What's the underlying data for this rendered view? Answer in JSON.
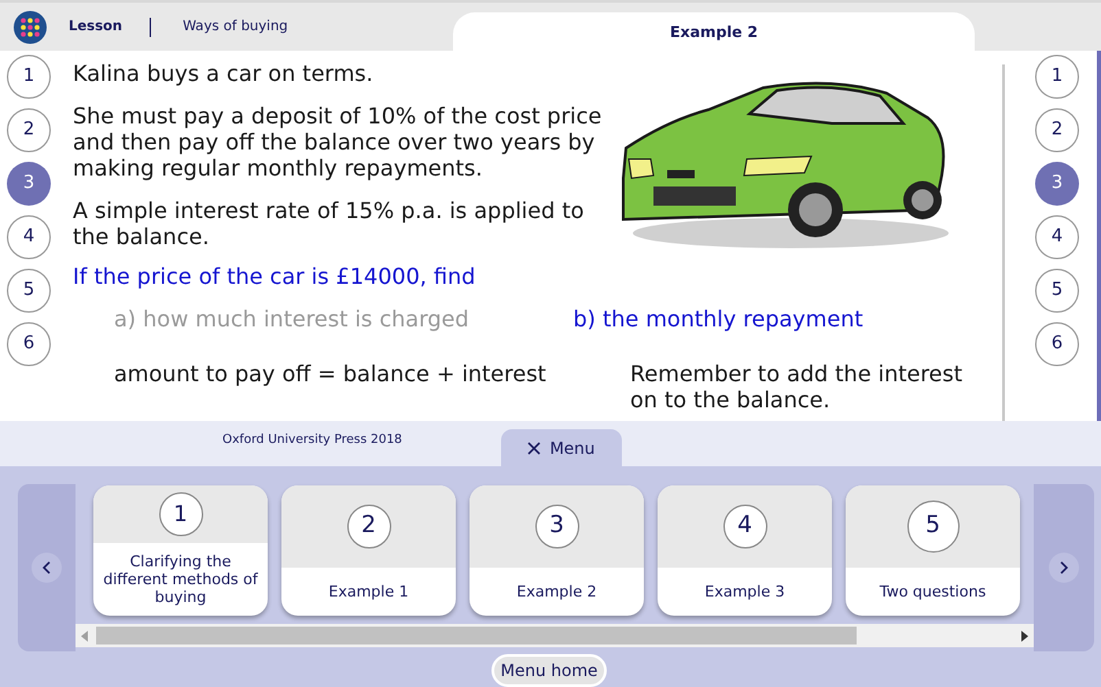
{
  "header": {
    "section": "Lesson",
    "title": "Ways of buying",
    "tab": "Example 2"
  },
  "nav_left": [
    {
      "label": "1",
      "selected": false
    },
    {
      "label": "2",
      "selected": false
    },
    {
      "label": "3",
      "selected": true
    },
    {
      "label": "4",
      "selected": false
    },
    {
      "label": "5",
      "selected": false
    },
    {
      "label": "6",
      "selected": false
    }
  ],
  "nav_right": [
    {
      "label": "1",
      "selected": false
    },
    {
      "label": "2",
      "selected": false
    },
    {
      "label": "3",
      "selected": true
    },
    {
      "label": "4",
      "selected": false
    },
    {
      "label": "5",
      "selected": false
    },
    {
      "label": "6",
      "selected": false
    }
  ],
  "content": {
    "paragraphs": [
      "Kalina buys a car on terms.",
      "She must pay a deposit of 10% of the cost price and then pay off the balance over two years by making regular monthly repayments.",
      "A simple interest rate of 15% p.a. is applied to the balance."
    ],
    "question": "If the price of the car is £14000, find",
    "parts": [
      {
        "text": "a) how much interest is charged",
        "active": false
      },
      {
        "text": "b) the monthly repayment",
        "active": true
      }
    ],
    "working": "amount to pay off = balance + interest",
    "hint": "Remember to add the interest on to the balance."
  },
  "footer": {
    "copyright": "Oxford University Press 2018",
    "menu_tab": "Menu",
    "menu_home": "Menu home"
  },
  "menu_cards": [
    {
      "number": "1",
      "title": "Clarifying the different methods of buying"
    },
    {
      "number": "2",
      "title": "Example 1"
    },
    {
      "number": "3",
      "title": "Example 2"
    },
    {
      "number": "4",
      "title": "Example 3"
    },
    {
      "number": "5",
      "title": "Two questions"
    }
  ]
}
